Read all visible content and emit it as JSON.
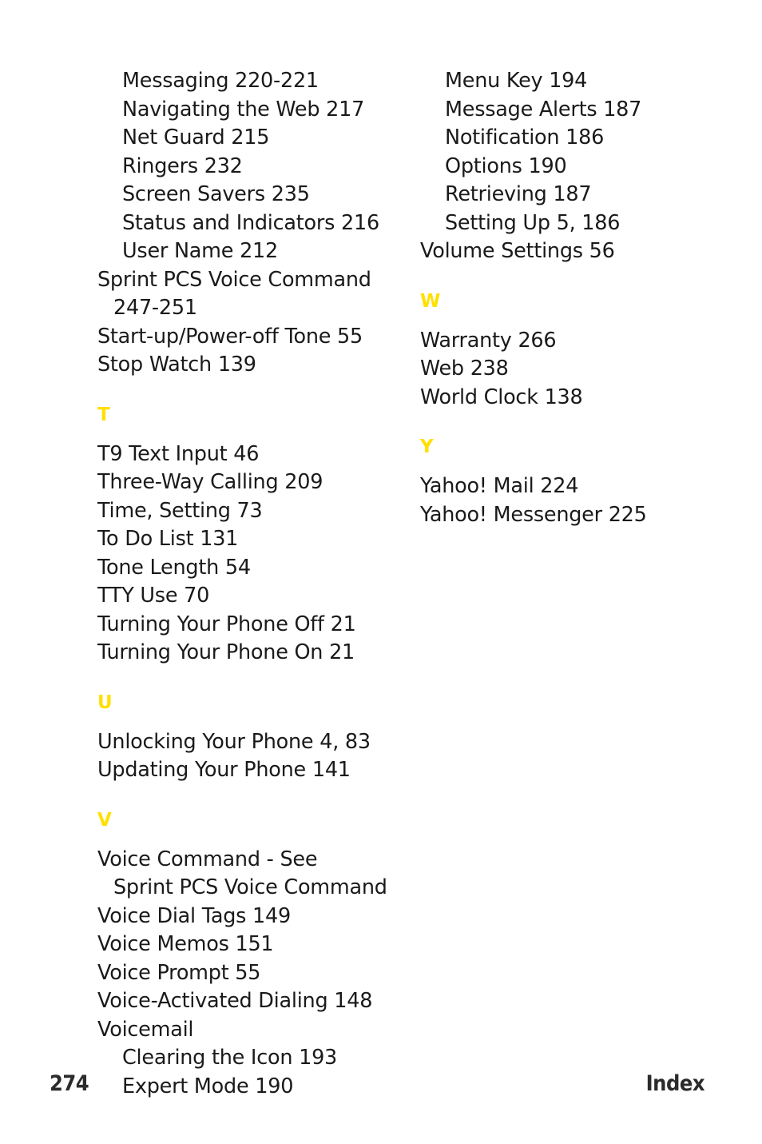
{
  "page": {
    "folio": "274",
    "running_head": "Index",
    "accent_color": "#ffe000",
    "text_color": "#1a1a1a",
    "background_color": "#ffffff"
  },
  "columns": [
    {
      "name": "left-column",
      "blocks": [
        {
          "type": "entries",
          "items": [
            {
              "text": "Messaging 220-221",
              "indent": 2
            },
            {
              "text": "Navigating the Web 217",
              "indent": 2
            },
            {
              "text": "Net Guard 215",
              "indent": 2
            },
            {
              "text": "Ringers 232",
              "indent": 2
            },
            {
              "text": "Screen Savers 235",
              "indent": 2
            },
            {
              "text": "Status and Indicators 216",
              "indent": 2
            },
            {
              "text": "User Name 212",
              "indent": 2
            },
            {
              "text": "Sprint PCS Voice Command",
              "indent": 0
            },
            {
              "text": "247-251",
              "indent": 1
            },
            {
              "text": "Start-up/Power-off Tone 55",
              "indent": 0
            },
            {
              "text": "Stop Watch 139",
              "indent": 0
            }
          ]
        },
        {
          "type": "section",
          "letter": "T",
          "items": [
            {
              "text": "T9 Text Input 46",
              "indent": 0
            },
            {
              "text": "Three-Way Calling 209",
              "indent": 0
            },
            {
              "text": "Time, Setting 73",
              "indent": 0
            },
            {
              "text": "To Do List 131",
              "indent": 0
            },
            {
              "text": "Tone Length 54",
              "indent": 0
            },
            {
              "text": "TTY Use 70",
              "indent": 0
            },
            {
              "text": "Turning Your Phone Off 21",
              "indent": 0
            },
            {
              "text": "Turning Your Phone On 21",
              "indent": 0
            }
          ]
        },
        {
          "type": "section",
          "letter": "U",
          "items": [
            {
              "text": "Unlocking Your Phone 4, 83",
              "indent": 0
            },
            {
              "text": "Updating Your Phone 141",
              "indent": 0
            }
          ]
        },
        {
          "type": "section",
          "letter": "V",
          "items": [
            {
              "text": "Voice Command - See",
              "indent": 0
            },
            {
              "text": "Sprint PCS Voice Command",
              "indent": 1
            },
            {
              "text": "Voice Dial Tags 149",
              "indent": 0
            },
            {
              "text": "Voice Memos 151",
              "indent": 0
            },
            {
              "text": "Voice Prompt 55",
              "indent": 0
            },
            {
              "text": "Voice-Activated Dialing 148",
              "indent": 0
            },
            {
              "text": "Voicemail",
              "indent": 0
            },
            {
              "text": "Clearing the Icon 193",
              "indent": 2
            },
            {
              "text": "Expert Mode 190",
              "indent": 2
            }
          ]
        }
      ]
    },
    {
      "name": "right-column",
      "blocks": [
        {
          "type": "entries",
          "items": [
            {
              "text": "Menu Key 194",
              "indent": 2
            },
            {
              "text": "Message Alerts 187",
              "indent": 2
            },
            {
              "text": "Notification 186",
              "indent": 2
            },
            {
              "text": "Options 190",
              "indent": 2
            },
            {
              "text": "Retrieving 187",
              "indent": 2
            },
            {
              "text": "Setting Up 5, 186",
              "indent": 2
            },
            {
              "text": "Volume Settings 56",
              "indent": 0
            }
          ]
        },
        {
          "type": "section",
          "letter": "W",
          "items": [
            {
              "text": "Warranty 266",
              "indent": 0
            },
            {
              "text": "Web 238",
              "indent": 0
            },
            {
              "text": "World Clock 138",
              "indent": 0
            }
          ]
        },
        {
          "type": "section",
          "letter": "Y",
          "items": [
            {
              "text": "Yahoo! Mail 224",
              "indent": 0
            },
            {
              "text": "Yahoo! Messenger 225",
              "indent": 0
            }
          ]
        }
      ]
    }
  ]
}
